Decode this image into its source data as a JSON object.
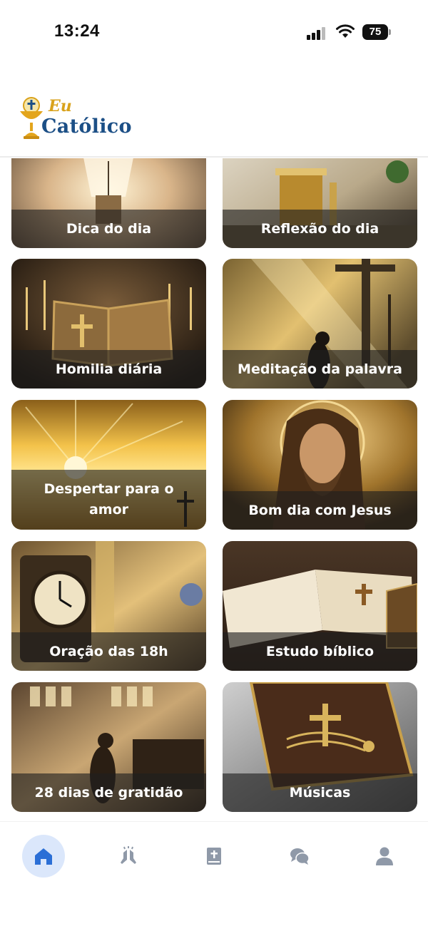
{
  "status_bar": {
    "time": "13:24",
    "battery": "75"
  },
  "header": {
    "logo_line1": "Eu",
    "logo_line2": "Católico"
  },
  "cards": [
    {
      "label": "Dica do dia",
      "icon": "lightbulb"
    },
    {
      "label": "Reflexão do dia",
      "icon": "altar"
    },
    {
      "label": "Homilia diária",
      "icon": "bible"
    },
    {
      "label": "Meditação da palavra",
      "icon": "praying-cross"
    },
    {
      "label": "Despertar para o amor",
      "icon": "sunrise"
    },
    {
      "label": "Bom dia com Jesus",
      "icon": "jesus"
    },
    {
      "label": "Oração das 18h",
      "icon": "clock"
    },
    {
      "label": "Estudo bíblico",
      "icon": "open-bible"
    },
    {
      "label": "28 dias de gratidão",
      "icon": "praying-woman"
    },
    {
      "label": "Músicas",
      "icon": "music-book"
    }
  ],
  "bottom_nav": [
    {
      "name": "home",
      "icon": "home-icon",
      "active": true
    },
    {
      "name": "prayers",
      "icon": "praying-hands-icon",
      "active": false
    },
    {
      "name": "bible",
      "icon": "bible-icon",
      "active": false
    },
    {
      "name": "chat",
      "icon": "chat-icon",
      "active": false
    },
    {
      "name": "profile",
      "icon": "user-icon",
      "active": false
    }
  ],
  "colors": {
    "accent": "#2b6fd6",
    "nav_inactive": "#8f99a8",
    "nav_active_bg": "#dbe7fb",
    "logo_blue": "#1c4f86",
    "logo_gold": "#d9a21b"
  }
}
